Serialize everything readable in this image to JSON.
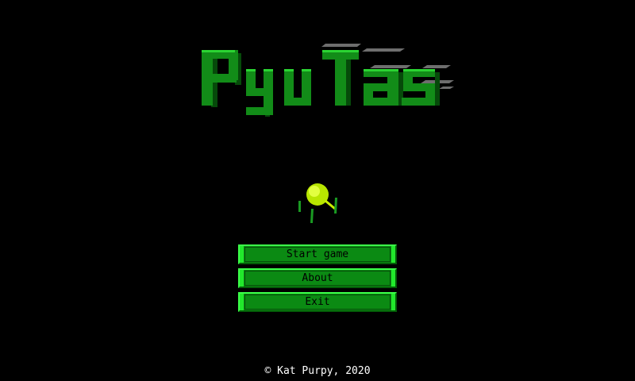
{
  "title": "PyuTas",
  "menu": {
    "start_label": "Start game",
    "about_label": "About",
    "exit_label": "Exit"
  },
  "footer": "© Kat Purpy, 2020",
  "colors": {
    "background": "#000000",
    "logo_green": "#128c18",
    "button_fill": "#0b8a13",
    "button_edge": "#22e82c",
    "player": "#c8f000"
  }
}
